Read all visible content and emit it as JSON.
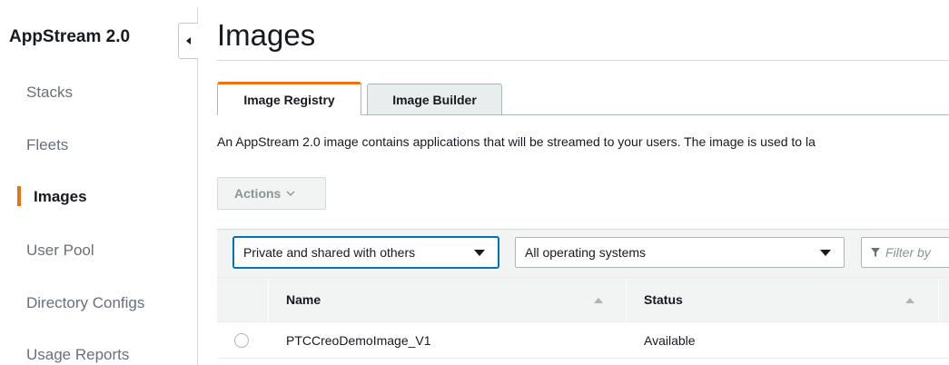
{
  "sidebar": {
    "title": "AppStream 2.0",
    "items": [
      {
        "label": "Stacks",
        "active": false
      },
      {
        "label": "Fleets",
        "active": false
      },
      {
        "label": "Images",
        "active": true
      },
      {
        "label": "User Pool",
        "active": false
      },
      {
        "label": "Directory Configs",
        "active": false
      },
      {
        "label": "Usage Reports",
        "active": false
      }
    ]
  },
  "main": {
    "title": "Images",
    "tabs": [
      {
        "label": "Image Registry",
        "active": true
      },
      {
        "label": "Image Builder",
        "active": false
      }
    ],
    "description": "An AppStream 2.0 image contains applications that will be streamed to your users. The image is used to la",
    "actions_label": "Actions",
    "filters": {
      "visibility_select": "Private and shared with others",
      "os_select": "All operating systems",
      "filter_placeholder": "Filter by"
    },
    "table": {
      "columns": [
        "Name",
        "Status"
      ],
      "rows": [
        {
          "name": "PTCCreoDemoImage_V1",
          "status": "Available"
        }
      ]
    }
  },
  "colors": {
    "accent": "#ec7211",
    "focus": "#0073bb"
  }
}
